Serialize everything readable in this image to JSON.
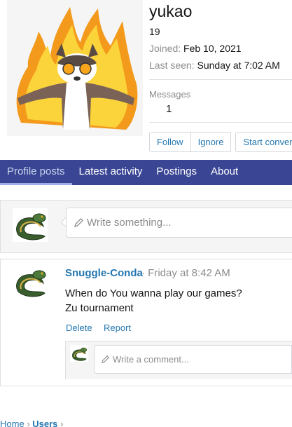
{
  "profile": {
    "username": "yukao",
    "age": "19",
    "joined_label": "Joined:",
    "joined_value": "Feb 10, 2021",
    "last_seen_label": "Last seen:",
    "last_seen_value": "Sunday at 7:02 AM",
    "messages_label": "Messages",
    "messages_value": "1",
    "buttons": {
      "follow": "Follow",
      "ignore": "Ignore",
      "start_conversation": "Start convers"
    }
  },
  "tabs": [
    {
      "label": "Profile posts",
      "active": true
    },
    {
      "label": "Latest activity",
      "active": false
    },
    {
      "label": "Postings",
      "active": false
    },
    {
      "label": "About",
      "active": false
    }
  ],
  "new_post": {
    "placeholder": "Write something..."
  },
  "post": {
    "author": "Snuggle-Conda",
    "time": "· Friday at 8:42 AM",
    "body_line1": "When do You wanna play our games?",
    "body_line2": "Zu tournament",
    "delete_label": "Delete",
    "report_label": "Report",
    "comment_placeholder": "Write a comment..."
  },
  "breadcrumb": {
    "home": "Home",
    "users": "Users"
  },
  "colors": {
    "tab_bar": "#3a4694",
    "link": "#2577b1",
    "muted": "#8c8c8c"
  },
  "icons": {
    "avatar": "flaming-raccoon-avatar",
    "snake": "snake-avatar",
    "pencil": "pencil-icon"
  }
}
